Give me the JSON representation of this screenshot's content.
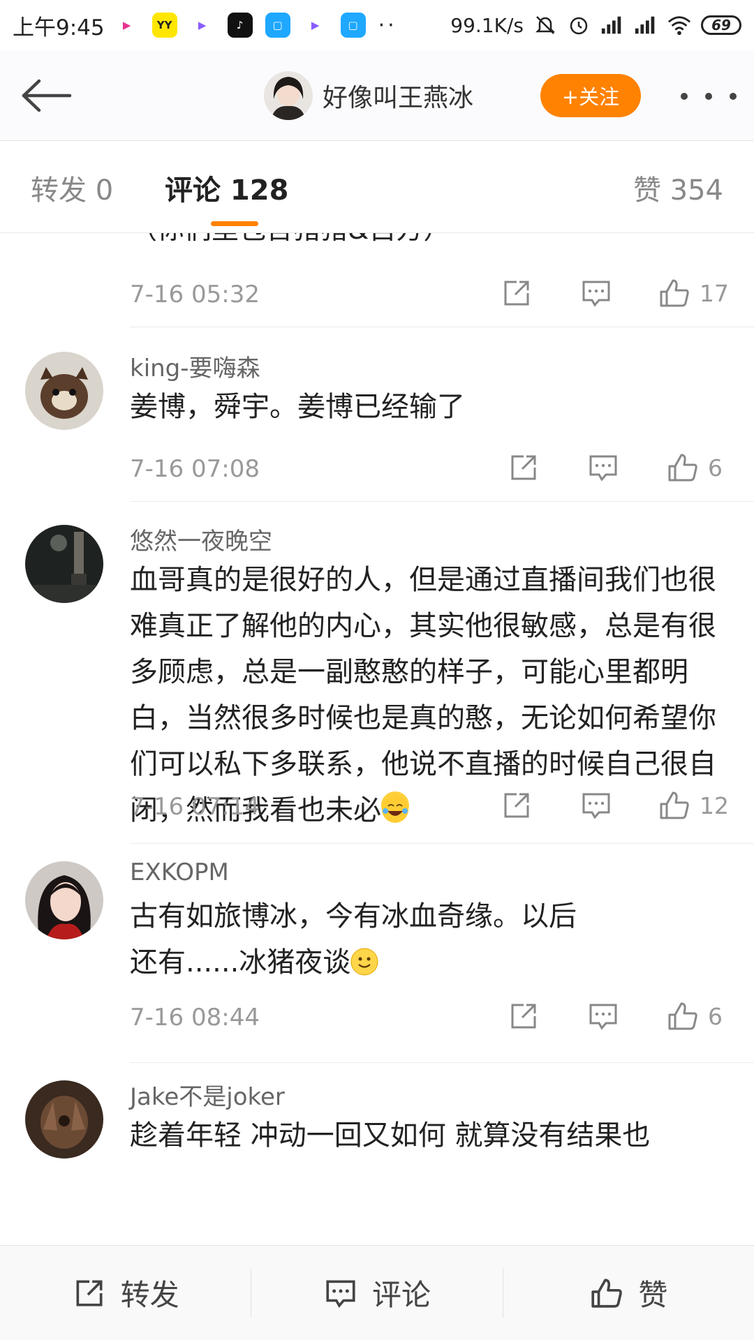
{
  "status_bar": {
    "time": "上午9:45",
    "apps": [
      {
        "name": "youku-icon",
        "label": "▶",
        "color": "#ffffff",
        "text_color": "#e8338f"
      },
      {
        "name": "yy-icon",
        "label": "YY",
        "color": "#ffe600",
        "text_color": "#222222"
      },
      {
        "name": "video-play-icon",
        "label": "▶",
        "color": "#ffffff",
        "text_color": "#8a5cff"
      },
      {
        "name": "tiktok-icon",
        "label": "♪",
        "color": "#111111",
        "text_color": "#ffffff"
      },
      {
        "name": "blue-square-icon",
        "label": "▢",
        "color": "#1fa8ff",
        "text_color": "#ffffff"
      },
      {
        "name": "video-play-icon-2",
        "label": "▶",
        "color": "#ffffff",
        "text_color": "#8a5cff"
      },
      {
        "name": "blue-square-icon-2",
        "label": "▢",
        "color": "#1fa8ff",
        "text_color": "#ffffff"
      }
    ],
    "more_dots": "··",
    "net_speed": "99.1K/s",
    "battery": "69"
  },
  "header": {
    "author_name": "好像叫王燕冰",
    "follow_label": "+关注"
  },
  "tabs": {
    "repost": "转发 0",
    "comment": "评论 128",
    "like": "赞 354"
  },
  "comments": {
    "clipped_first": {
      "text_partial": "（你们里包含猪猪&自方）",
      "time": "7-16 05:32",
      "likes": "17"
    },
    "items": [
      {
        "user": "king-要嗨森",
        "text": "姜博，舜宇。姜博已经输了",
        "time": "7-16 07:08",
        "likes": "6"
      },
      {
        "user": "悠然一夜晚空",
        "text": "血哥真的是很好的人，但是通过直播间我们也很难真正了解他的内心，其实他很敏感，总是有很多顾虑，总是一副憨憨的样子，可能心里都明白，当然很多时候也是真的憨，无论如何希望你们可以私下多联系，他说不直播的时候自己很自闭，然而我看也未必",
        "time": "7-16 07:14",
        "likes": "12"
      },
      {
        "user": "EXKOPM",
        "text": "古有如旅博冰，今有冰血奇缘。以后还有......冰猪夜谈",
        "time": "7-16 08:44",
        "likes": "6"
      },
      {
        "user": "Jake不是joker",
        "text": "趁着年轻 冲动一回又如何 就算没有结果也",
        "time": "",
        "likes": ""
      }
    ]
  },
  "bottom_bar": {
    "repost": "转发",
    "comment": "评论",
    "like": "赞"
  },
  "colors": {
    "accent": "#ff8200",
    "text_primary": "#222222",
    "text_secondary": "#999999"
  }
}
